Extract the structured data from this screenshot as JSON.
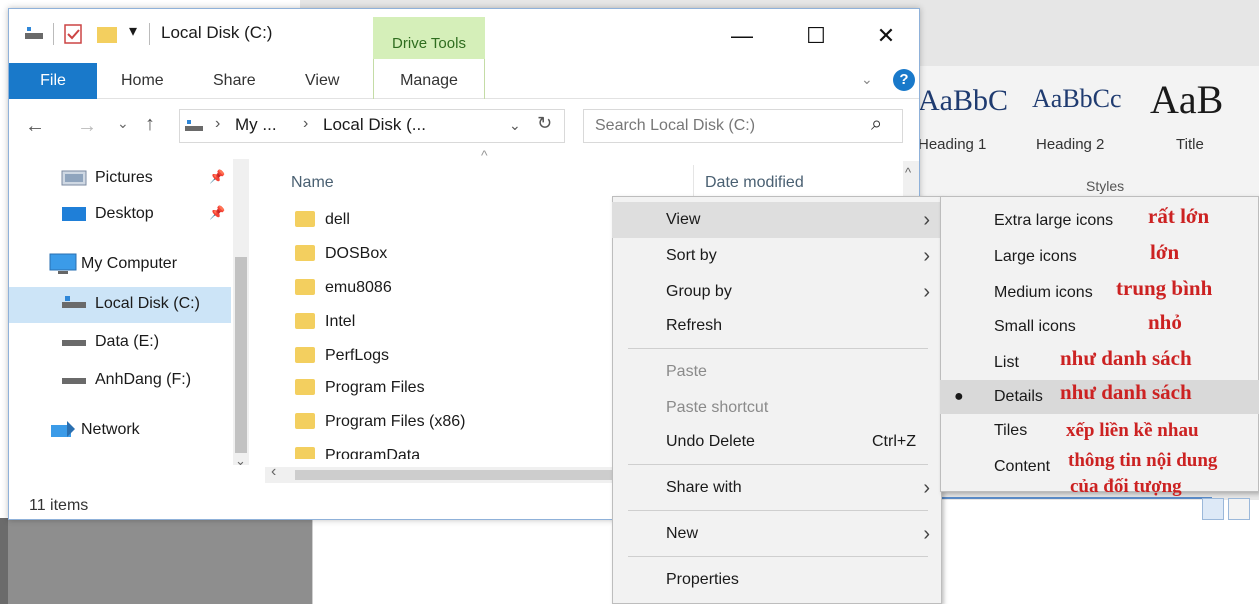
{
  "window": {
    "title": "Local Disk (C:)"
  },
  "ribbon": {
    "context_group": "Drive Tools",
    "tabs": [
      "File",
      "Home",
      "Share",
      "View",
      "Manage"
    ]
  },
  "window_controls": {
    "minimize": "—",
    "maximize": "☐",
    "close": "✕"
  },
  "address": {
    "back": "←",
    "forward": "→",
    "recent": "⌄",
    "up": "↑",
    "path": [
      "My ...",
      "Local Disk (..."
    ],
    "separator": "›",
    "dropdown": "⌄",
    "refresh": "↻"
  },
  "search": {
    "placeholder": "Search Local Disk (C:)",
    "icon": "⌕"
  },
  "nav": [
    {
      "label": "Pictures",
      "icon": "pictures-icon",
      "pinned": true
    },
    {
      "label": "Desktop",
      "icon": "desktop-icon",
      "pinned": true
    },
    {
      "label": "My Computer",
      "icon": "computer-icon"
    },
    {
      "label": "Local Disk (C:)",
      "icon": "drive-icon",
      "selected": true
    },
    {
      "label": "Data (E:)",
      "icon": "drive-icon"
    },
    {
      "label": "AnhDang (F:)",
      "icon": "drive-icon"
    },
    {
      "label": "Network",
      "icon": "network-icon"
    }
  ],
  "columns": {
    "name": "Name",
    "date": "Date modified"
  },
  "files": [
    "dell",
    "DOSBox",
    "emu8086",
    "Intel",
    "PerfLogs",
    "Program Files",
    "Program Files (x86)",
    "ProgramData"
  ],
  "status": "11 items",
  "context_menu": {
    "view": "View",
    "sort_by": "Sort by",
    "group_by": "Group by",
    "refresh": "Refresh",
    "paste": "Paste",
    "paste_shortcut": "Paste shortcut",
    "undo_delete": "Undo Delete",
    "undo_shortcut": "Ctrl+Z",
    "share_with": "Share with",
    "new": "New",
    "properties": "Properties",
    "submenu_arrow": "›"
  },
  "view_submenu": [
    {
      "label": "Extra large icons",
      "note": "rất lớn"
    },
    {
      "label": "Large icons",
      "note": "lớn"
    },
    {
      "label": "Medium icons",
      "note": "trung bình"
    },
    {
      "label": "Small icons",
      "note": "nhỏ"
    },
    {
      "label": "List",
      "note": "như danh sách"
    },
    {
      "label": "Details",
      "note": "như danh sách",
      "selected": true
    },
    {
      "label": "Tiles",
      "note": "xếp liền kề nhau"
    },
    {
      "label": "Content",
      "note": "thông tin nội dung",
      "note2": "của đối tượng"
    }
  ],
  "word_styles": {
    "previews": [
      "AaBbC",
      "AaBbCc",
      "AaB"
    ],
    "labels": [
      "Heading 1",
      "Heading 2",
      "Title"
    ],
    "group": "Styles"
  },
  "colors": {
    "file_tab": "#1979ca",
    "drive_tools": "#d5efb9",
    "selection": "#cce4f7",
    "annotation": "#cc2222"
  }
}
